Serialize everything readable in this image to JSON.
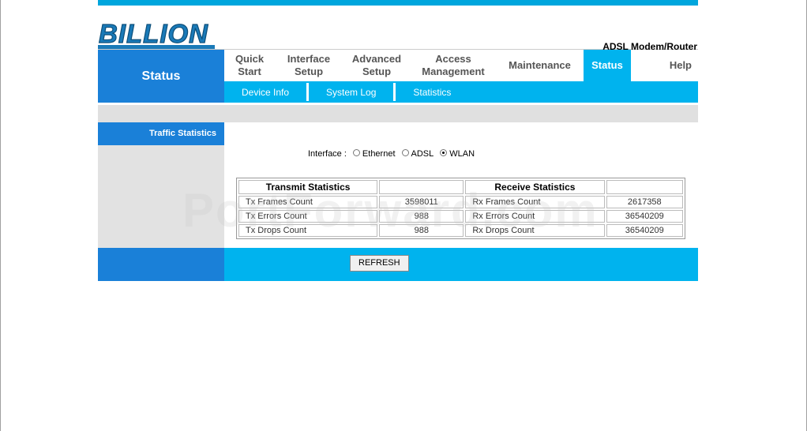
{
  "brand": {
    "logo_text": "BILLION",
    "product": "ADSL Modem/Router"
  },
  "nav": {
    "section_title": "Status",
    "menu": [
      {
        "label": "Quick Start"
      },
      {
        "label": "Interface Setup"
      },
      {
        "label": "Advanced Setup"
      },
      {
        "label": "Access Management"
      },
      {
        "label": "Maintenance"
      },
      {
        "label": "Status"
      },
      {
        "label": "Help"
      }
    ],
    "submenu": [
      {
        "label": "Device Info"
      },
      {
        "label": "System Log"
      },
      {
        "label": "Statistics"
      }
    ]
  },
  "sidebar": {
    "title": "Traffic Statistics"
  },
  "interface": {
    "label": "Interface :",
    "options": [
      "Ethernet",
      "ADSL",
      "WLAN"
    ],
    "selected": "WLAN"
  },
  "table": {
    "headers": [
      "Transmit Statistics",
      "",
      "Receive Statistics",
      ""
    ],
    "rows": [
      {
        "tx_label": "Tx Frames Count",
        "tx_value": "3598011",
        "rx_label": "Rx Frames Count",
        "rx_value": "2617358"
      },
      {
        "tx_label": "Tx Errors Count",
        "tx_value": "988",
        "rx_label": "Rx Errors Count",
        "rx_value": "36540209"
      },
      {
        "tx_label": "Tx Drops Count",
        "tx_value": "988",
        "rx_label": "Rx Drops Count",
        "rx_value": "36540209"
      }
    ]
  },
  "refresh_label": "REFRESH",
  "watermark": "PortForward.com",
  "colors": {
    "dark_blue": "#1a80d8",
    "light_blue": "#00b3ee",
    "top_bar": "#00a6dd"
  }
}
